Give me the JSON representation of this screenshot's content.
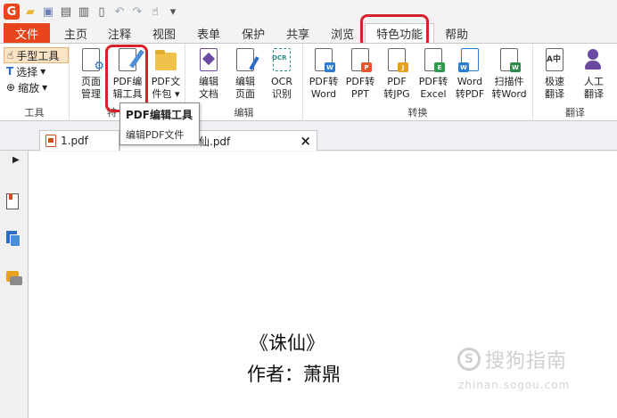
{
  "quick_access": {
    "logo_letter": "G",
    "dropdown_glyph": "▾"
  },
  "tabs": [
    {
      "label": "文件"
    },
    {
      "label": "主页"
    },
    {
      "label": "注释"
    },
    {
      "label": "视图"
    },
    {
      "label": "表单"
    },
    {
      "label": "保护"
    },
    {
      "label": "共享"
    },
    {
      "label": "浏览"
    },
    {
      "label": "特色功能"
    },
    {
      "label": "帮助"
    }
  ],
  "active_tab": "特色功能",
  "ribbon": {
    "tools_group": {
      "label": "工具",
      "items": [
        {
          "label": "手型工具",
          "icon": "hand-icon"
        },
        {
          "label": "选择",
          "icon": "text-select-icon"
        },
        {
          "label": "缩放",
          "icon": "zoom-icon"
        }
      ]
    },
    "feature_group": {
      "label": "特",
      "buttons": [
        {
          "label": "页面\n管理",
          "icon": "page-manage-icon"
        },
        {
          "label": "PDF编\n辑工具",
          "icon": "pdf-edit-icon"
        },
        {
          "label": "PDF文\n件包 ▾",
          "icon": "pdf-package-icon"
        }
      ]
    },
    "edit_group": {
      "label": "编辑",
      "buttons": [
        {
          "label": "编辑\n文档",
          "icon": "edit-document-icon"
        },
        {
          "label": "编辑\n页面",
          "icon": "edit-page-icon"
        },
        {
          "label": "OCR\n识别",
          "icon": "ocr-icon",
          "badge": "OCR"
        }
      ]
    },
    "convert_group": {
      "label": "转换",
      "buttons": [
        {
          "label": "PDF转\nWord",
          "icon": "pdf-to-word-icon",
          "badge": "W",
          "color": "#2b7cd3"
        },
        {
          "label": "PDF转\nPPT",
          "icon": "pdf-to-ppt-icon",
          "badge": "P",
          "color": "#e0572a"
        },
        {
          "label": "PDF\n转JPG",
          "icon": "pdf-to-jpg-icon",
          "badge": "J",
          "color": "#e6a21c"
        },
        {
          "label": "PDF转\nExcel",
          "icon": "pdf-to-excel-icon",
          "badge": "E",
          "color": "#2e9a4b"
        },
        {
          "label": "Word\n转PDF",
          "icon": "word-to-pdf-icon",
          "badge": "W",
          "color": "#2b7cd3"
        },
        {
          "label": "扫描件\n转Word",
          "icon": "scan-to-word-icon",
          "badge": "W",
          "color": "#2e8a4b"
        }
      ]
    },
    "translate_group": {
      "label": "翻译",
      "buttons": [
        {
          "label": "极速\n翻译",
          "icon": "fast-translate-icon",
          "badge": "A中"
        },
        {
          "label": "人工\n翻译",
          "icon": "human-translate-icon"
        }
      ]
    }
  },
  "tooltip": {
    "title": "PDF编辑工具",
    "description": "编辑PDF文件"
  },
  "document_tabs": [
    {
      "label": "1.pdf"
    },
    {
      "label": "仙.pdf",
      "close": "×"
    }
  ],
  "document": {
    "title": "《诛仙》",
    "author": "作者：萧鼎"
  },
  "watermark": {
    "logo_letter": "S",
    "text": "搜狗指南",
    "url": "zhinan.sogou.com"
  },
  "colors": {
    "brand_orange": "#e8451c",
    "highlight_red": "#d9212b",
    "word_blue": "#2b7cd3",
    "ppt_orange": "#e0572a",
    "jpg_yellow": "#e6a21c",
    "excel_green": "#2e9a4b"
  }
}
